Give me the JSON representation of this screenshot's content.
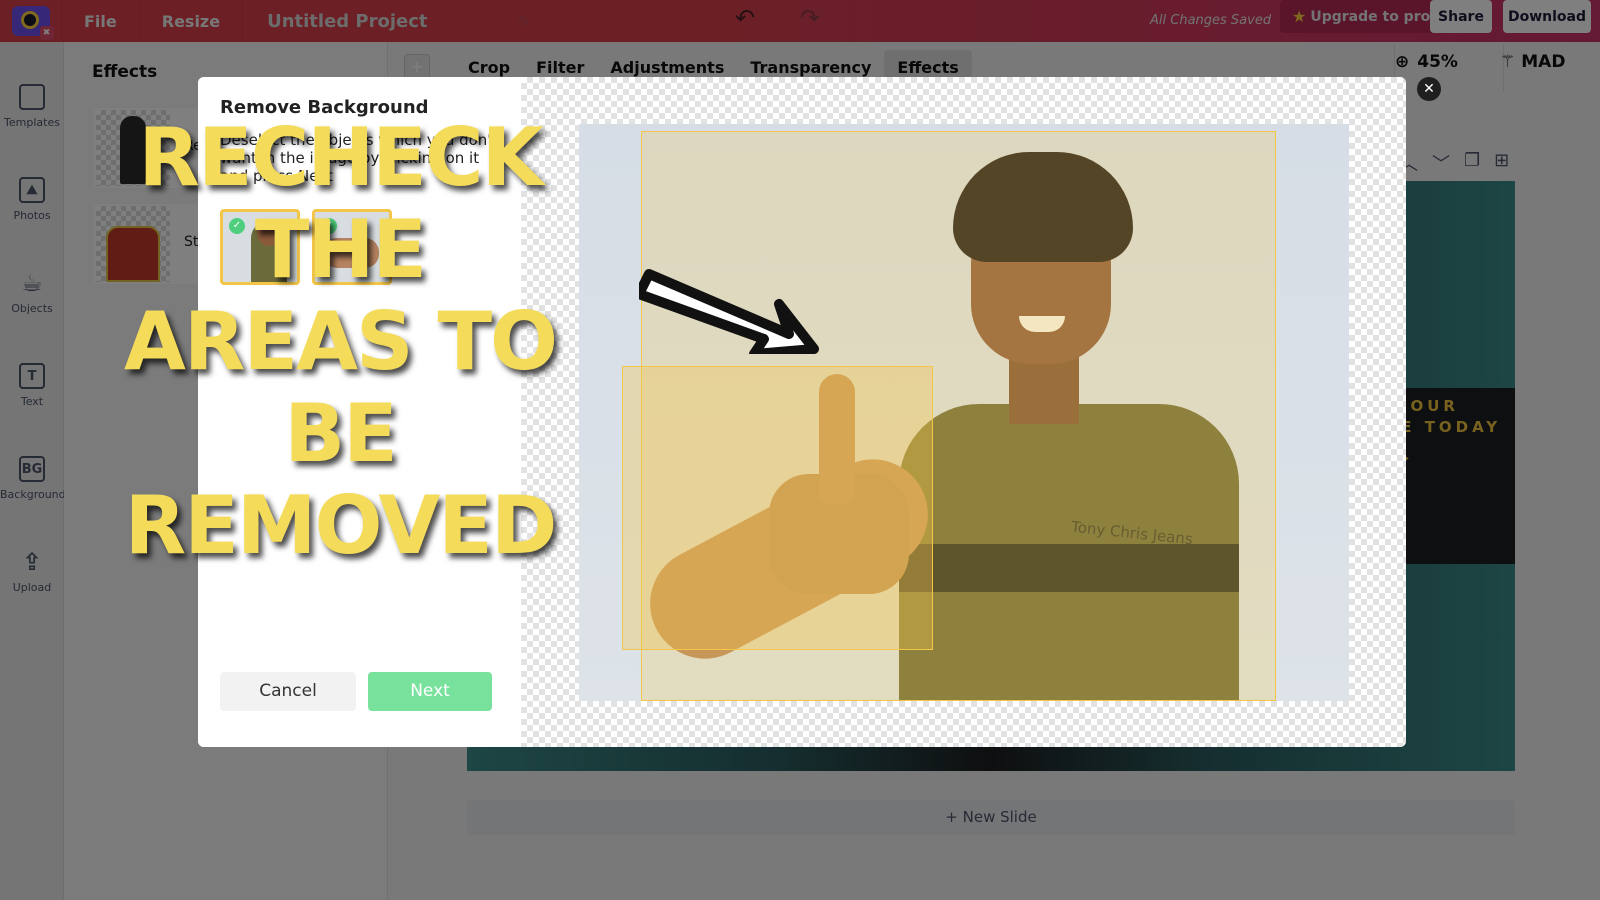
{
  "topbar": {
    "menu": [
      "File",
      "Resize"
    ],
    "project_title": "Untitled Project",
    "status": "All Changes Saved",
    "upgrade_label": "Upgrade to pro",
    "share_label": "Share",
    "download_label": "Download",
    "brand_color": "#d9414a"
  },
  "rail": {
    "items": [
      {
        "label": "Templates",
        "icon": "templates-icon"
      },
      {
        "label": "Photos",
        "icon": "photos-icon"
      },
      {
        "label": "Objects",
        "icon": "cup-icon"
      },
      {
        "label": "Text",
        "icon": "text-icon",
        "glyph": "T"
      },
      {
        "label": "Background",
        "icon": "background-icon",
        "glyph": "BG"
      },
      {
        "label": "Upload",
        "icon": "upload-icon"
      }
    ]
  },
  "panel": {
    "title": "Effects",
    "cards": [
      {
        "label": "Remove Background"
      },
      {
        "label": "Sticker"
      }
    ]
  },
  "toolbar": {
    "tabs": [
      "Crop",
      "Filter",
      "Adjustments",
      "Transparency",
      "Effects"
    ],
    "active_tab": "Effects",
    "zoom_level": "45%",
    "magic_label": "MAD"
  },
  "slide": {
    "text": "T OUR\nTE TODAY",
    "new_slide_label": "+ New Slide"
  },
  "modal": {
    "title": "Remove Background",
    "description": "Deselect the objects which you don't want in the image by clicking on it and press Next",
    "objects": [
      {
        "name": "person",
        "selected": true
      },
      {
        "name": "hand",
        "selected": true
      }
    ],
    "cancel_label": "Cancel",
    "next_label": "Next",
    "shirt_text": "Tony Chris Jeans",
    "accent_color": "#78e29d",
    "selection_color": "#f3c64a"
  },
  "headline": {
    "lines": [
      "RECHECK THE",
      "AREAS TO BE",
      "REMOVED"
    ]
  }
}
